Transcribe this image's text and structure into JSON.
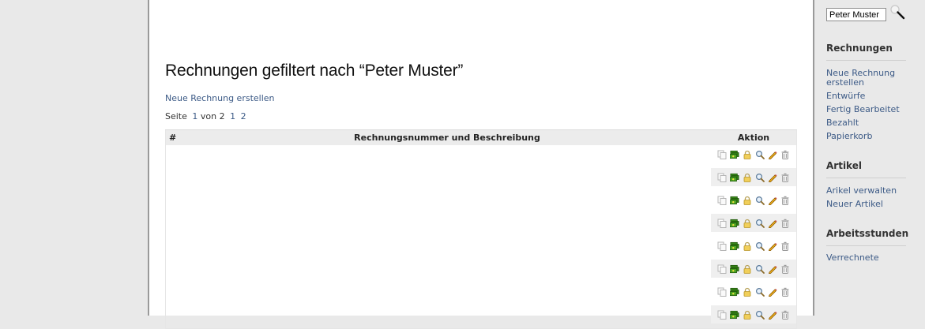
{
  "main": {
    "title": "Rechnungen gefiltert nach “Peter Muster”",
    "new_invoice_link": "Neue Rechnung erstellen",
    "pager": {
      "prefix": "Seite",
      "current": "1",
      "of": "von",
      "total": "2",
      "pages": [
        "1",
        "2"
      ]
    }
  },
  "table": {
    "headers": {
      "number": "#",
      "description": "Rechnungsnummer und Beschreibung",
      "action": "Aktion"
    },
    "row_count": 8,
    "action_icons": [
      "copy-icon",
      "money-icon",
      "lock-icon",
      "search-icon",
      "pencil-icon",
      "trash-icon"
    ]
  },
  "sidebar": {
    "search_value": "Peter Muster",
    "sections": [
      {
        "title": "Rechnungen",
        "links": [
          "Neue Rechnung erstellen",
          "Entwürfe",
          "Fertig Bearbeitet",
          "Bezahlt",
          "Papierkorb"
        ]
      },
      {
        "title": "Artikel",
        "links": [
          "Arikel verwalten",
          "Neuer Artikel"
        ]
      },
      {
        "title": "Arbeitsstunden",
        "links": [
          "Verrechnete"
        ]
      }
    ]
  },
  "colors": {
    "link": "#3c5a86",
    "header_bg": "#ececec",
    "alt_row": "#efefef",
    "frame": "#9a9a9a",
    "page_bg": "#e9e9e9"
  }
}
